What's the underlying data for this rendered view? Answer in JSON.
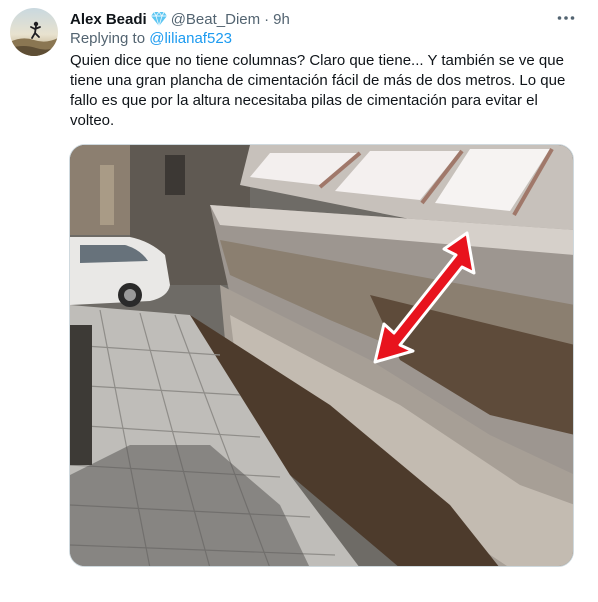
{
  "author": {
    "name": "Alex Beadi",
    "handle": "@Beat_Diem",
    "separator": "·",
    "time": "9h",
    "badge_icon": "verified-diamond-icon",
    "badge_color": "#5cc6f2"
  },
  "reply": {
    "prefix": "Replying to ",
    "mention": "@lilianaf523"
  },
  "tweet_text": "Quien dice que no tiene columnas? Claro que tiene... Y también se ve que tiene una gran plancha de cimentación fácil de más de dos metros. Lo que fallo es que por la altura necesitaba pilas de cimentación para evitar el volteo.",
  "more_icon": "more-dots-icon",
  "media": {
    "kind": "photo",
    "description_icon": "toppled-building-photo",
    "arrow_color": "#e8131d"
  },
  "colors": {
    "text": "#0f1419",
    "secondary": "#536471",
    "link": "#1d9bf0"
  }
}
